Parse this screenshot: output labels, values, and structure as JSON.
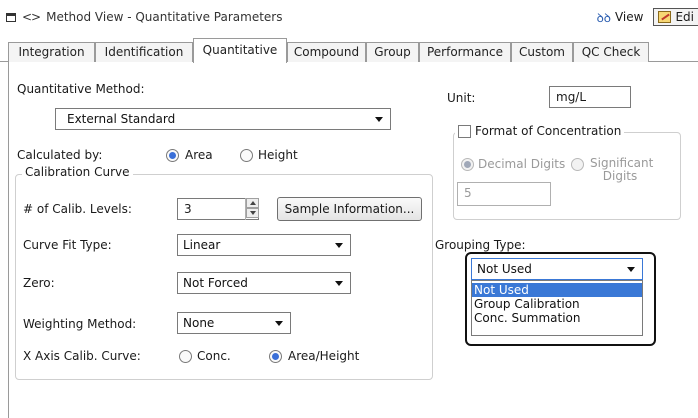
{
  "title": {
    "text": "Method View - Quantitative Parameters",
    "view_label": "View",
    "edit_label": "Edi"
  },
  "tabs": [
    {
      "label": "Integration"
    },
    {
      "label": "Identification"
    },
    {
      "label": "Quantitative",
      "active": true
    },
    {
      "label": "Compound"
    },
    {
      "label": "Group"
    },
    {
      "label": "Performance"
    },
    {
      "label": "Custom"
    },
    {
      "label": "QC Check"
    }
  ],
  "quant": {
    "method_label": "Quantitative Method:",
    "method_value": "External Standard",
    "calculated_by_label": "Calculated by:",
    "calc_options": [
      {
        "label": "Area",
        "selected": true
      },
      {
        "label": "Height",
        "selected": false
      }
    ]
  },
  "calibration": {
    "legend": "Calibration Curve",
    "levels_label": "# of Calib. Levels:",
    "levels_value": "3",
    "sample_info_button": "Sample Information...",
    "curve_fit_label": "Curve Fit Type:",
    "curve_fit_value": "Linear",
    "zero_label": "Zero:",
    "zero_value": "Not Forced",
    "weighting_label": "Weighting Method:",
    "weighting_value": "None",
    "xaxis_label": "X Axis Calib. Curve:",
    "xaxis_options": [
      {
        "label": "Conc.",
        "selected": false
      },
      {
        "label": "Area/Height",
        "selected": true
      }
    ]
  },
  "unit": {
    "label": "Unit:",
    "value": "mg/L"
  },
  "concentration": {
    "legend": "Format of Concentration",
    "checked": false,
    "decimal_label": "Decimal Digits",
    "significant_label": "Significant Digits",
    "digits_value": "5"
  },
  "grouping": {
    "label": "Grouping Type:",
    "selected": "Not Used",
    "options": [
      "Not Used",
      "Group Calibration",
      "Conc. Summation"
    ]
  },
  "colors": {
    "selection": "#3a78d6",
    "radio_dot": "#3a6fd8"
  }
}
